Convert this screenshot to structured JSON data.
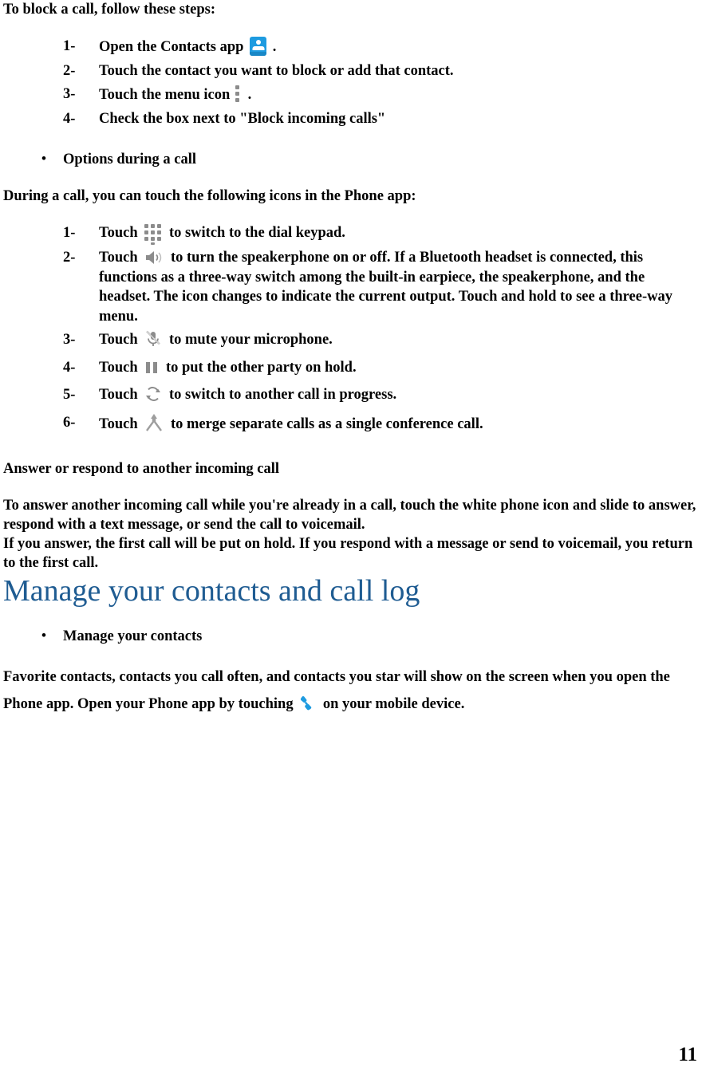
{
  "document": {
    "page_number": "11",
    "accent_heading_color": "#1F5C92",
    "icon_blue": "#1E9BE0",
    "icon_grey": "#8c8c8c"
  },
  "block_call": {
    "intro": "To block a call, follow these steps:",
    "steps": [
      {
        "num": "1-",
        "text_before": "Open the Contacts app",
        "icon": "contacts-app-icon",
        "text_after": "."
      },
      {
        "num": "2-",
        "text_before": "Touch the contact you want to block or add that contact.",
        "icon": "",
        "text_after": ""
      },
      {
        "num": "3-",
        "text_before": "Touch the menu icon",
        "icon": "overflow-menu-icon",
        "text_after": "."
      },
      {
        "num": "4-",
        "text_before": "Check the box next to \"Block incoming calls\"",
        "icon": "",
        "text_after": ""
      }
    ]
  },
  "options_during_call": {
    "bullet_label": "Options during a call",
    "intro": "During a call, you can touch the following icons in the Phone app:",
    "steps": [
      {
        "num": "1-",
        "lead": "Touch",
        "icon": "dial-keypad-icon",
        "text": "to switch to the dial keypad."
      },
      {
        "num": "2-",
        "lead": "Touch",
        "icon": "speakerphone-icon",
        "text": "to turn the speakerphone on or off. If a Bluetooth headset is connected, this functions as a three-way switch among the built-in earpiece, the speakerphone, and the headset. The icon changes to indicate the current output. Touch and hold to see a three-way menu."
      },
      {
        "num": "3-",
        "lead": "Touch",
        "icon": "mute-microphone-icon",
        "text": "to mute your microphone."
      },
      {
        "num": "4-",
        "lead": "Touch",
        "icon": "hold-call-icon",
        "text": "to put the other party on hold."
      },
      {
        "num": "5-",
        "lead": "Touch",
        "icon": "swap-call-icon",
        "text": "to switch to another call in progress."
      },
      {
        "num": "6-",
        "lead": "Touch",
        "icon": "merge-call-icon",
        "text": "to merge separate calls as a single conference call."
      }
    ]
  },
  "answer_another_call": {
    "heading": "Answer or respond to another incoming call",
    "paragraph_1": "To answer another incoming call while you're already in a call, touch the white phone icon and slide to answer, respond with a text message, or send the call to voicemail.",
    "paragraph_2": "If you answer, the first call will be put on hold. If you respond with a message or send to voicemail, you return to the first call."
  },
  "manage_section": {
    "chapter_title": "Manage your contacts and call log",
    "bullet_label": "Manage your contacts",
    "body_part_1": "Favorite contacts, contacts you call often, and contacts you star will show on the screen when you open the Phone app. Open your Phone app by touching",
    "phone_icon": "phone-handset-icon",
    "body_part_2": "on your mobile device."
  }
}
